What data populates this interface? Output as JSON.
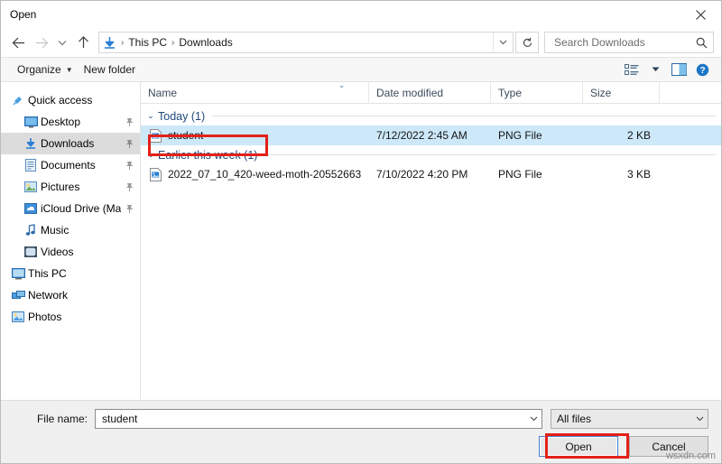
{
  "window": {
    "title": "Open",
    "close_label": "×"
  },
  "nav": {
    "back_icon": "back-arrow-icon",
    "forward_icon": "forward-arrow-icon",
    "recent_icon": "recent-locations-chevron-icon",
    "up_icon": "up-arrow-icon",
    "refresh_icon": "refresh-icon",
    "breadcrumb": [
      "This PC",
      "Downloads"
    ],
    "separator": "›",
    "folder_icon": "downloads-folder-icon",
    "address_chevron": "chevron-down-icon"
  },
  "search": {
    "placeholder": "Search Downloads",
    "value": "",
    "icon": "search-icon"
  },
  "toolbar": {
    "organize_label": "Organize",
    "organize_caret": "▼",
    "new_folder_label": "New folder",
    "view_icon": "view-layout-icon",
    "view_caret": "▼",
    "preview_pane_icon": "preview-pane-icon",
    "help_icon": "help-icon"
  },
  "sidebar": {
    "items": [
      {
        "label": "Quick access",
        "icon": "pin-star-icon",
        "indent": 0,
        "pinned": false,
        "selected": false
      },
      {
        "label": "Desktop",
        "icon": "desktop-icon",
        "indent": 1,
        "pinned": true,
        "selected": false
      },
      {
        "label": "Downloads",
        "icon": "downloads-icon",
        "indent": 1,
        "pinned": true,
        "selected": true
      },
      {
        "label": "Documents",
        "icon": "documents-icon",
        "indent": 1,
        "pinned": true,
        "selected": false
      },
      {
        "label": "Pictures",
        "icon": "pictures-icon",
        "indent": 1,
        "pinned": true,
        "selected": false
      },
      {
        "label": "iCloud Drive (Ma",
        "icon": "icloud-drive-icon",
        "indent": 1,
        "pinned": true,
        "selected": false
      },
      {
        "label": "Music",
        "icon": "music-icon",
        "indent": 1,
        "pinned": false,
        "selected": false
      },
      {
        "label": "Videos",
        "icon": "videos-icon",
        "indent": 1,
        "pinned": false,
        "selected": false
      },
      {
        "label": "This PC",
        "icon": "this-pc-icon",
        "indent": 0,
        "pinned": false,
        "selected": false
      },
      {
        "label": "Network",
        "icon": "network-icon",
        "indent": 0,
        "pinned": false,
        "selected": false
      },
      {
        "label": "Photos",
        "icon": "photos-icon",
        "indent": 0,
        "pinned": false,
        "selected": false
      }
    ],
    "pin_glyph": "📌"
  },
  "filelist": {
    "columns": [
      {
        "key": "name",
        "label": "Name"
      },
      {
        "key": "date",
        "label": "Date modified"
      },
      {
        "key": "type",
        "label": "Type"
      },
      {
        "key": "size",
        "label": "Size"
      }
    ],
    "sort_column": "Date modified",
    "sort_indicator": "⌄",
    "groups": [
      {
        "label": "Today (1)",
        "chevron": "⌄",
        "rows": [
          {
            "name": "student",
            "date": "7/12/2022 2:45 AM",
            "type": "PNG File",
            "size": "2 KB",
            "icon": "png-file-icon",
            "selected": true
          }
        ]
      },
      {
        "label": "Earlier this week (1)",
        "chevron": "⌄",
        "rows": [
          {
            "name": "2022_07_10_420-weed-moth-20552663",
            "date": "7/10/2022 4:20 PM",
            "type": "PNG File",
            "size": "3 KB",
            "icon": "png-file-icon",
            "selected": false
          }
        ]
      }
    ]
  },
  "footer": {
    "filename_label": "File name:",
    "filename_value": "student",
    "filename_caret": "⌄",
    "filter_value": "All files",
    "filter_caret": "⌄",
    "open_label": "Open",
    "cancel_label": "Cancel"
  },
  "watermark": "wsxdn.com",
  "colors": {
    "selection_blue": "#cde8f9",
    "sidebar_selection": "#dcdcdc",
    "group_header_text": "#20497b",
    "annotation_red": "#e32119",
    "focus_blue": "#4a7fd1",
    "accent_icon_blue": "#2a7fd4"
  }
}
